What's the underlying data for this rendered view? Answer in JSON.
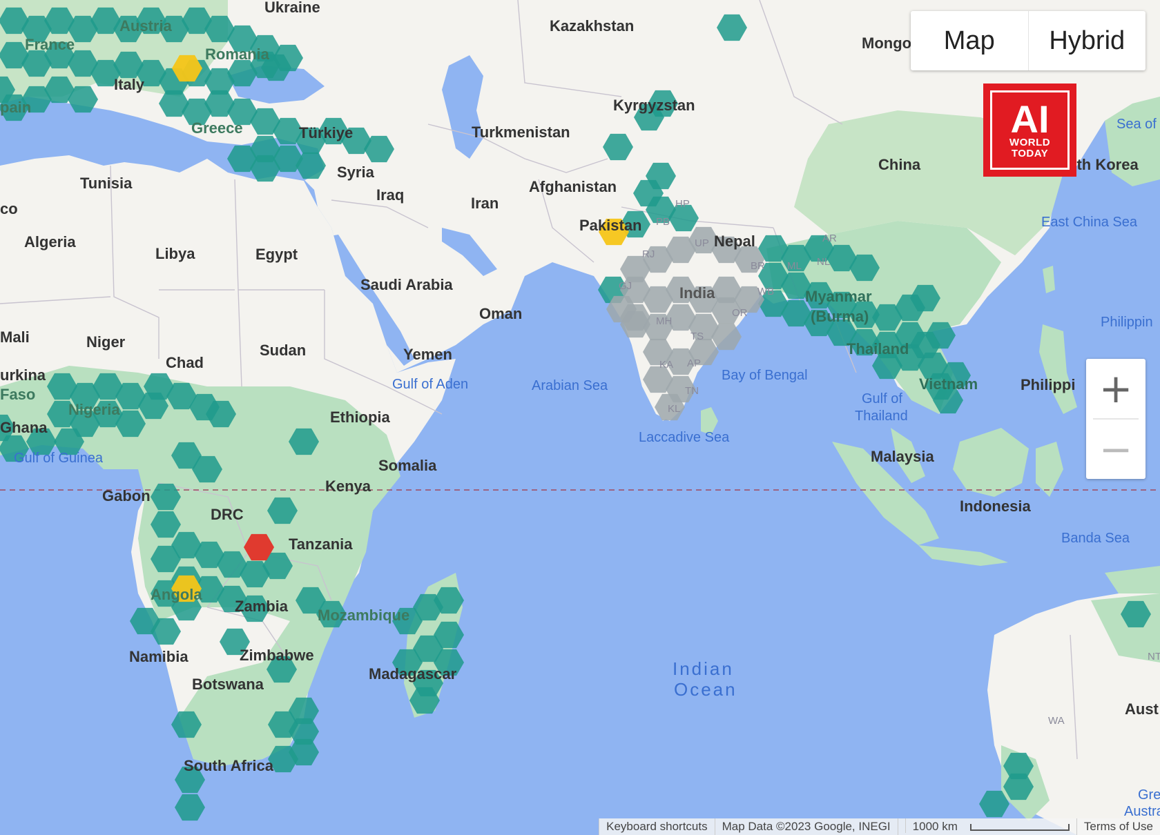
{
  "map_type": {
    "options": [
      "Map",
      "Hybrid"
    ],
    "selected": "Map"
  },
  "logo": {
    "main": "AI",
    "line1": "WORLD",
    "line2": "TODAY"
  },
  "zoom": {
    "in_symbol": "+",
    "out_symbol": "−"
  },
  "footer": {
    "shortcuts": "Keyboard shortcuts",
    "map_data": "Map Data ©2023 Google, INEGI",
    "scale": "1000 km",
    "terms": "Terms of Use"
  },
  "legend_colors": {
    "water": "#8fb4f2",
    "land": "#f4f3ef",
    "vegetation": "#b9e0c0",
    "hex_teal": "#1f9a8c",
    "hex_gray": "#9ea7ac",
    "hex_yellow": "#f5c518",
    "hex_red": "#e03a2f"
  },
  "labels": {
    "countries": {
      "ukraine": "Ukraine",
      "kazakhstan": "Kazakhstan",
      "mongolia": "Mongo",
      "austria": "Austria",
      "france": "France",
      "romania": "Romania",
      "italy": "Italy",
      "spain": "pain",
      "greece": "Greece",
      "turkiye": "Türkiye",
      "kyrgyzstan": "Kyrgyzstan",
      "turkmenistan": "Turkmenistan",
      "china": "China",
      "south_korea": "uth Korea",
      "tunisia": "Tunisia",
      "syria": "Syria",
      "iraq": "Iraq",
      "afghanistan": "Afghanistan",
      "iran": "Iran",
      "pakistan": "Pakistan",
      "nepal": "Nepal",
      "algeria": "Algeria",
      "libya": "Libya",
      "egypt": "Egypt",
      "saudi_arabia": "Saudi Arabia",
      "india": "India",
      "myanmar": "Myanmar",
      "burma": "(Burma)",
      "oman": "Oman",
      "mali": "Mali",
      "niger": "Niger",
      "sudan": "Sudan",
      "yemen": "Yemen",
      "chad": "Chad",
      "thailand": "Thailand",
      "vietnam": "Vietnam",
      "philippines": "Philippi",
      "burkina": "urkina",
      "faso": "Faso",
      "nigeria": "Nigeria",
      "ethiopia": "Ethiopia",
      "ghana": "Ghana",
      "somalia": "Somalia",
      "malaysia": "Malaysia",
      "kenya": "Kenya",
      "gabon": "Gabon",
      "drc": "DRC",
      "indonesia": "Indonesia",
      "tanzania": "Tanzania",
      "angola": "Angola",
      "zambia": "Zambia",
      "mozambique": "Mozambique",
      "namibia": "Namibia",
      "zimbabwe": "Zimbabwe",
      "madagascar": "Madagascar",
      "botswana": "Botswana",
      "south_africa": "South Africa",
      "australia": "Aust",
      "morocco": "co"
    },
    "water": {
      "sea_of_japan": "Sea of",
      "east_china_sea": "East China Sea",
      "philippine_sea": "Philippin",
      "gulf_of_aden": "Gulf of Aden",
      "arabian_sea": "Arabian Sea",
      "bay_of_bengal": "Bay of Bengal",
      "gulf_of_thailand_1": "Gulf of",
      "gulf_of_thailand_2": "Thailand",
      "gulf_of_guinea": "Gulf of Guinea",
      "laccadive_sea": "Laccadive Sea",
      "banda_sea": "Banda Sea",
      "indian_ocean_1": "Indian",
      "indian_ocean_2": "Ocean",
      "great_australian_1": "Great",
      "great_australian_2": "Australia"
    },
    "states": {
      "up": "UP",
      "rj": "RJ",
      "gj": "GJ",
      "mh": "MH",
      "ts": "TS",
      "ka": "KA",
      "ap": "AP",
      "tn": "TN",
      "kl": "KL",
      "or": "OR",
      "br": "BR",
      "wb": "WB",
      "pb": "PB",
      "hp": "HP",
      "ml": "ML",
      "nl": "NL",
      "ar": "AR",
      "wa": "WA",
      "nt": "NT"
    }
  }
}
